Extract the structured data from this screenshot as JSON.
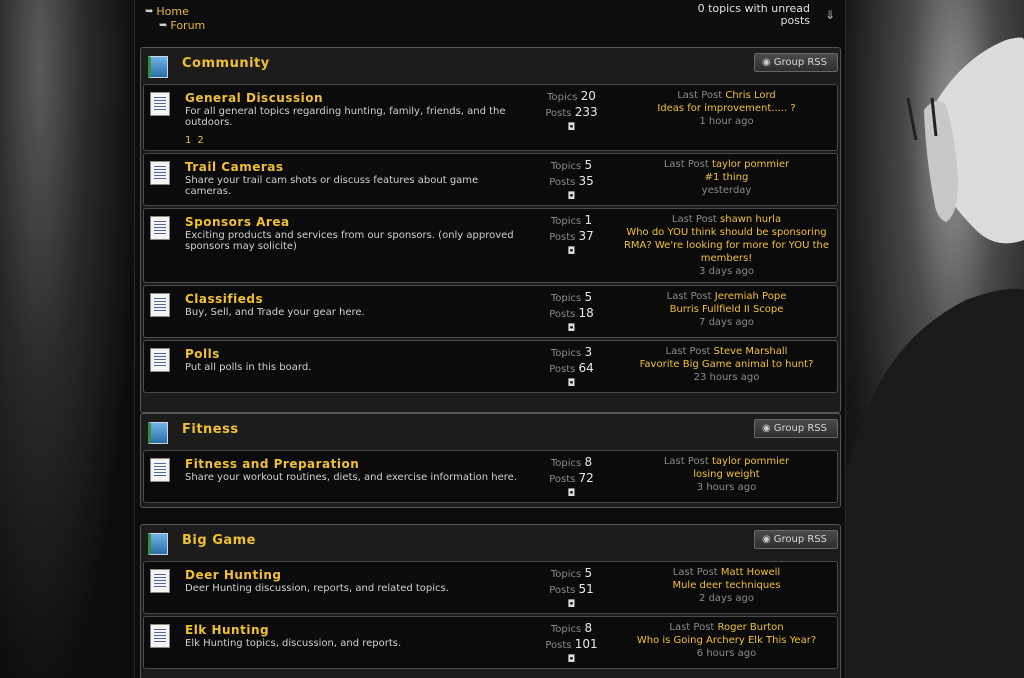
{
  "breadcrumb": {
    "home": "Home",
    "forum": "Forum"
  },
  "unread": {
    "text": "0 topics with unread posts"
  },
  "rss_label": "Group RSS",
  "last_post_label": "Last Post",
  "topics_label": "Topics",
  "posts_label": "Posts",
  "groups": [
    {
      "title": "Community",
      "boards": [
        {
          "title": "General Discussion",
          "desc": "For all general topics regarding hunting, family, friends, and the outdoors.",
          "pages": [
            "1",
            "2"
          ],
          "topics": "20",
          "posts": "233",
          "author": "Chris Lord",
          "topic": "Ideas for improvement..... ?",
          "when": "1 hour ago"
        },
        {
          "title": "Trail Cameras",
          "desc": "Share your trail cam shots or discuss features about game cameras.",
          "topics": "5",
          "posts": "35",
          "author": "taylor pommier",
          "topic": "#1 thing",
          "when": "yesterday"
        },
        {
          "title": "Sponsors Area",
          "desc": "Exciting products and services from our sponsors. (only approved sponsors may solicite)",
          "topics": "1",
          "posts": "37",
          "author": "shawn hurla",
          "topic": "Who do YOU think should be sponsoring RMA? We're looking for more for YOU the members!",
          "when": "3 days ago"
        },
        {
          "title": "Classifieds",
          "desc": "Buy, Sell, and Trade your gear here.",
          "topics": "5",
          "posts": "18",
          "author": "Jeremiah Pope",
          "topic": "Burris Fullfield II Scope",
          "when": "7 days ago"
        },
        {
          "title": "Polls",
          "desc": "Put all polls in this board.",
          "topics": "3",
          "posts": "64",
          "author": "Steve Marshall",
          "topic": "Favorite Big Game animal to hunt?",
          "when": "23 hours ago"
        }
      ]
    },
    {
      "title": "Fitness",
      "boards": [
        {
          "title": "Fitness and Preparation",
          "desc": "Share your workout routines, diets, and exercise information here.",
          "topics": "8",
          "posts": "72",
          "author": "taylor pommier",
          "topic": "losing weight",
          "when": "3 hours ago"
        }
      ]
    },
    {
      "title": "Big Game",
      "boards": [
        {
          "title": "Deer Hunting",
          "desc": "Deer Hunting discussion, reports, and related topics.",
          "topics": "5",
          "posts": "51",
          "author": "Matt Howell",
          "topic": "Mule deer techniques",
          "when": "2 days ago"
        },
        {
          "title": "Elk Hunting",
          "desc": "Elk Hunting topics, discussion, and reports.",
          "topics": "8",
          "posts": "101",
          "author": "Roger Burton",
          "topic": "Who is Going Archery Elk This Year?",
          "when": "6 hours ago"
        }
      ]
    }
  ]
}
